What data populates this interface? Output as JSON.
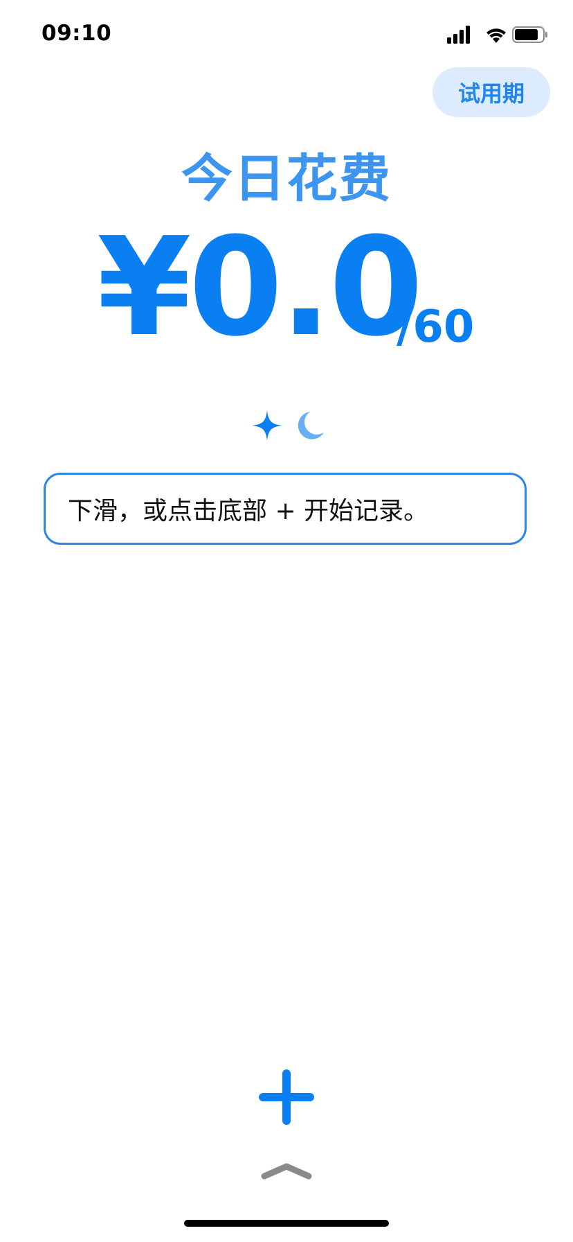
{
  "status_bar": {
    "time": "09:10",
    "icons": [
      "cellular-signal-icon",
      "wifi-icon",
      "battery-icon"
    ]
  },
  "trial_badge": {
    "label": "试用期"
  },
  "header": {
    "title": "今日花费"
  },
  "spending": {
    "amount": "¥0.0",
    "limit": "/60"
  },
  "mode_icons": [
    "sparkle-icon",
    "moon-icon"
  ],
  "hint": {
    "text": "下滑，或点击底部 + 开始记录。"
  },
  "bottom": {
    "add_icon": "plus-icon",
    "handle_icon": "chevron-up-icon"
  },
  "colors": {
    "accent": "#0a7ff2",
    "title": "#3c95f0",
    "badge_bg": "#dcebfd",
    "badge_text": "#1f86ee",
    "border": "#2b86e8",
    "moon": "#6aaef5",
    "handle": "#8a8a8e"
  }
}
